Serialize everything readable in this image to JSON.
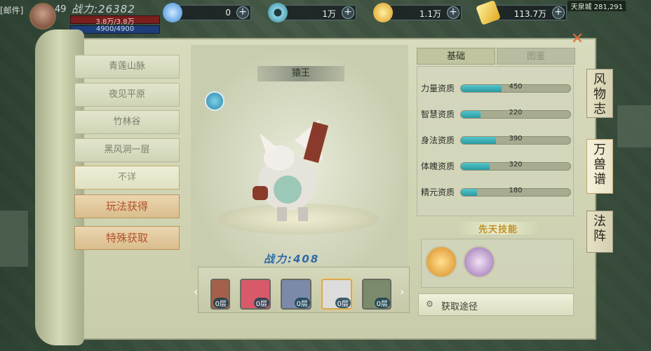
{
  "topbar": {
    "mail_label": "[邮件]",
    "level": "49",
    "power": "战力:26382",
    "hp": "3.8万/3.8万",
    "mp": "4900/4900",
    "currencies": [
      {
        "value": "0",
        "icon": "crescent-silver-icon",
        "color": "#4aa0e8"
      },
      {
        "value": "1万",
        "icon": "jade-disc-icon",
        "color": "#8ad0e0"
      },
      {
        "value": "1.1万",
        "icon": "gold-coin-icon",
        "color": "#e8b830"
      },
      {
        "value": "113.7万",
        "icon": "gold-ingot-icon",
        "color": "#f0c830"
      }
    ],
    "coords": "天泉城 281,291"
  },
  "left_list": {
    "items": [
      "青莲山脉",
      "夜见平原",
      "竹林谷",
      "黑风洞一层",
      "不详"
    ],
    "selected_index": 4,
    "actions": [
      "玩法获得",
      "特殊获取"
    ]
  },
  "display": {
    "name": "猿王",
    "power": "战力:408"
  },
  "carousel": {
    "slots": [
      {
        "layer": "0层",
        "color": "#a4604a"
      },
      {
        "layer": "0层",
        "color": "#d85a6a"
      },
      {
        "layer": "0层",
        "color": "#7a8aa8"
      },
      {
        "layer": "0层",
        "color": "#dcdcdc"
      },
      {
        "layer": "0层",
        "color": "#7a8a6a"
      }
    ],
    "active_index": 3
  },
  "tabs": {
    "basic": "基础",
    "atlas": "图鉴"
  },
  "stats": [
    {
      "label": "力量资质",
      "value": "450",
      "ratio": 0.37
    },
    {
      "label": "智慧资质",
      "value": "220",
      "ratio": 0.18
    },
    {
      "label": "身法资质",
      "value": "390",
      "ratio": 0.32
    },
    {
      "label": "体魄资质",
      "value": "320",
      "ratio": 0.26
    },
    {
      "label": "精元资质",
      "value": "180",
      "ratio": 0.15
    }
  ],
  "skills": {
    "title": "先天技能",
    "items": [
      {
        "icon": "golden-staff-skill-icon",
        "color": "#e8a830"
      },
      {
        "icon": "purple-claw-skill-icon",
        "color": "#b890c8"
      }
    ]
  },
  "acquire_label": "获取途径",
  "side_tabs": [
    "风物志",
    "万兽谱",
    "法阵"
  ],
  "side_tab_active": 1
}
